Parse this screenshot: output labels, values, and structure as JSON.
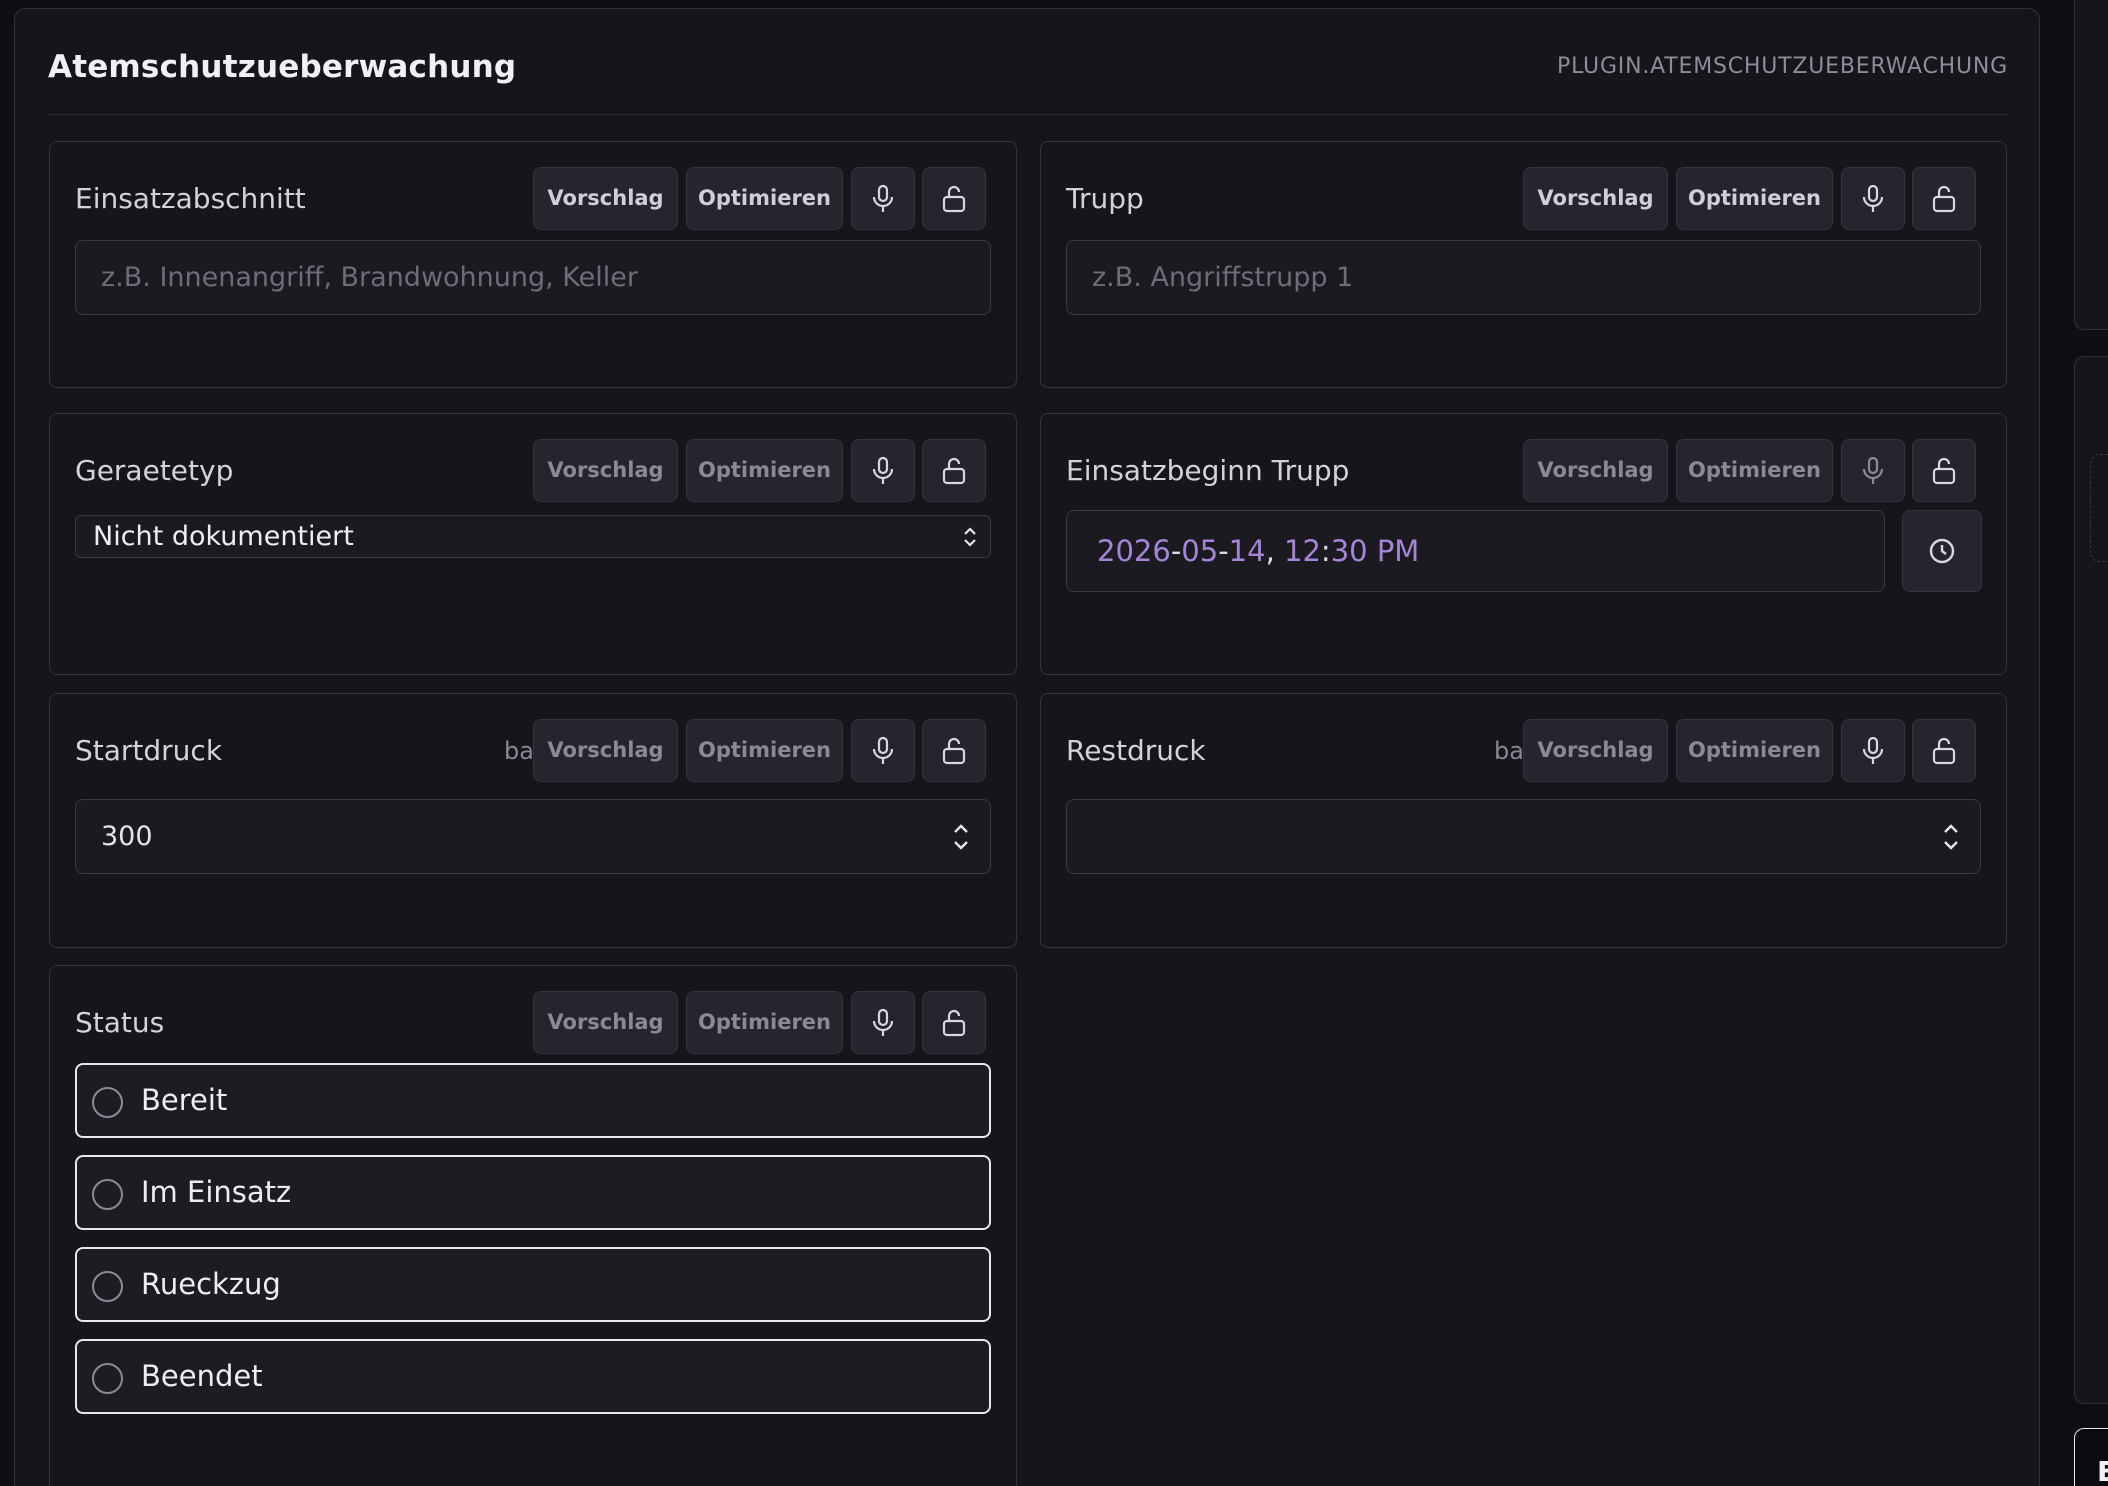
{
  "panel": {
    "title": "Atemschutzueberwachung",
    "plugin_id": "PLUGIN.ATEMSCHUTZUEBERWACHUNG"
  },
  "actions": {
    "suggest_label": "Vorschlag",
    "optimize_label": "Optimieren"
  },
  "fields": {
    "einsatzabschnitt": {
      "label": "Einsatzabschnitt",
      "placeholder": "z.B. Innenangriff, Brandwohnung, Keller",
      "value": ""
    },
    "trupp": {
      "label": "Trupp",
      "placeholder": "z.B. Angriffstrupp 1",
      "value": ""
    },
    "geraetetyp": {
      "label": "Geraetetyp",
      "selected": "Nicht dokumentiert"
    },
    "einsatzbeginn": {
      "label": "Einsatzbeginn Trupp",
      "year": "2026",
      "month": "05",
      "day": "14",
      "hour": "12",
      "minute": "30",
      "ampm": "PM",
      "sep_dash": "-",
      "sep_comma": ",",
      "sep_colon": ":"
    },
    "startdruck": {
      "label": "Startdruck",
      "unit": "bar",
      "value": "300"
    },
    "restdruck": {
      "label": "Restdruck",
      "unit": "bar",
      "value": ""
    },
    "status": {
      "label": "Status",
      "options": [
        "Bereit",
        "Im Einsatz",
        "Rueckzug",
        "Beendet"
      ]
    }
  },
  "side": {
    "button_label": "E"
  },
  "icons": {
    "mic": "microphone-icon",
    "lock": "unlock-icon",
    "clock": "clock-icon",
    "spin": "chevron-up-down-icon"
  },
  "colors": {
    "background": "#0f0e13",
    "panel": "#16151b",
    "accent_date": "#a585d6",
    "border": "#34333b"
  }
}
